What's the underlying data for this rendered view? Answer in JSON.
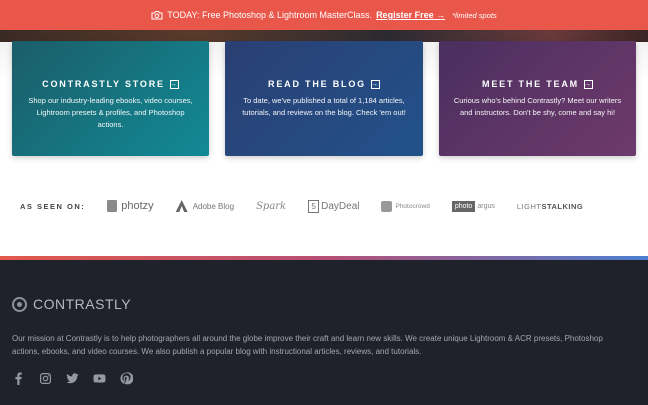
{
  "banner": {
    "text": "TODAY: Free Photoshop & Lightroom MasterClass.",
    "cta": "Register Free →",
    "note": "*limited spots",
    "color": "#e9574b"
  },
  "cards": [
    {
      "title": "CONTRASTLY STORE",
      "desc": "Shop our industry-leading ebooks, video courses, Lightroom presets & profiles, and Photoshop actions."
    },
    {
      "title": "READ THE BLOG",
      "desc": "To date, we've published a total of 1,184 articles, tutorials, and reviews on the blog. Check 'em out!"
    },
    {
      "title": "MEET THE TEAM",
      "desc": "Curious who's behind Contrastly? Meet our writers and instructors. Don't be shy, come and say hi!"
    }
  ],
  "seen_on": {
    "label": "AS SEEN ON:",
    "logos": [
      "photzy",
      "Adobe Blog",
      "Spark",
      "DayDeal",
      "Photocrowd",
      "photo",
      "argus",
      "LIGHT",
      "STALKING"
    ]
  },
  "footer": {
    "brand": "CONTRASTLY",
    "mission": "Our mission at Contrastly is to help photographers all around the globe improve their craft and learn new skills. We create unique Lightroom & ACR presets, Photoshop actions, ebooks, and video courses. We also publish a popular blog with instructional articles, reviews, and tutorials.",
    "social_icons": [
      "facebook-icon",
      "instagram-icon",
      "twitter-icon",
      "youtube-icon",
      "pinterest-icon"
    ]
  }
}
